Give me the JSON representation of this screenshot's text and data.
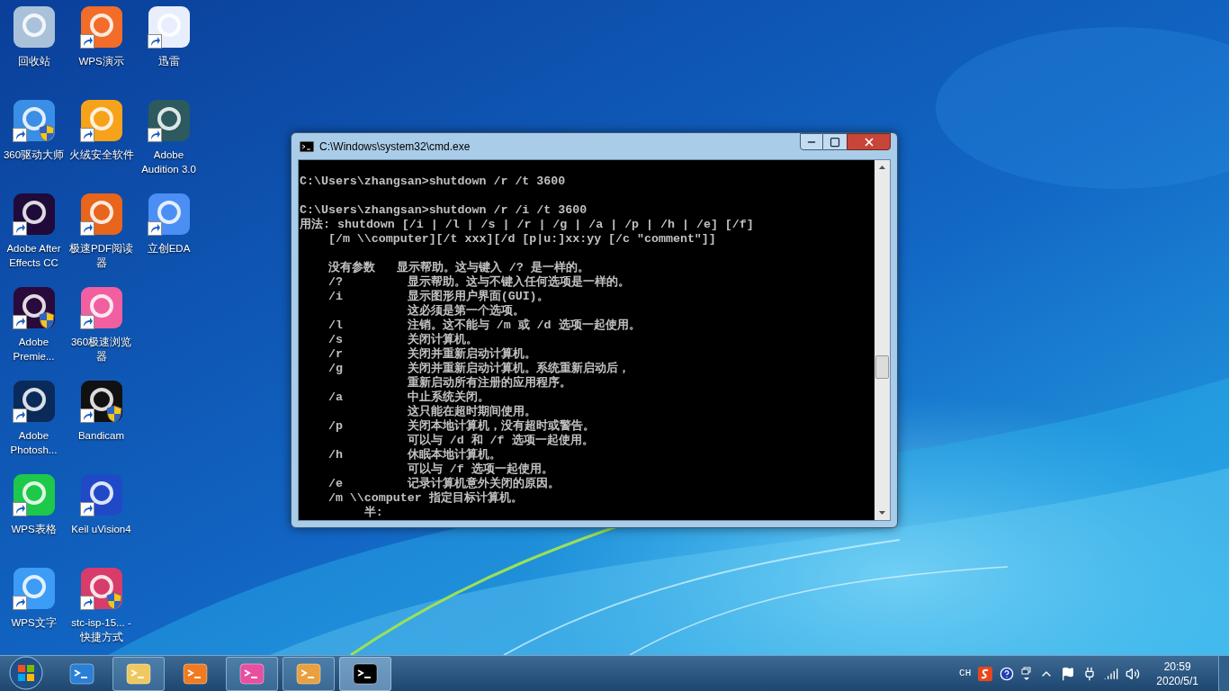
{
  "desktop": {
    "icons": [
      {
        "label": "回收站",
        "color": "#a9c2da",
        "shortcut": false,
        "shield": false
      },
      {
        "label": "360驱动大师",
        "color": "#3a8ee6",
        "shortcut": true,
        "shield": true
      },
      {
        "label": "Adobe After Effects CC",
        "color": "#1f0a3a",
        "shortcut": true,
        "shield": false
      },
      {
        "label": "Adobe Premie...",
        "color": "#2a0a3a",
        "shortcut": true,
        "shield": true
      },
      {
        "label": "Adobe Photosh...",
        "color": "#0a2a5a",
        "shortcut": true,
        "shield": false
      },
      {
        "label": "WPS表格",
        "color": "#1ec84a",
        "shortcut": true,
        "shield": false
      },
      {
        "label": "WPS文字",
        "color": "#3d9cf5",
        "shortcut": true,
        "shield": false
      },
      {
        "label": "WPS演示",
        "color": "#f26c2a",
        "shortcut": true,
        "shield": false
      },
      {
        "label": "火绒安全软件",
        "color": "#f7a21b",
        "shortcut": true,
        "shield": false
      },
      {
        "label": "极速PDF阅读器",
        "color": "#e8651c",
        "shortcut": true,
        "shield": false
      },
      {
        "label": "360极速浏览器",
        "color": "#f15fa0",
        "shortcut": true,
        "shield": false
      },
      {
        "label": "Bandicam",
        "color": "#111111",
        "shortcut": true,
        "shield": true
      },
      {
        "label": "Keil uVision4",
        "color": "#2049c8",
        "shortcut": true,
        "shield": false
      },
      {
        "label": "stc-isp-15... - 快捷方式",
        "color": "#d83c6a",
        "shortcut": true,
        "shield": true
      },
      {
        "label": "迅雷",
        "color": "#e8eefc",
        "shortcut": true,
        "shield": false
      },
      {
        "label": "Adobe Audition 3.0",
        "color": "#2c5a5e",
        "shortcut": true,
        "shield": false
      },
      {
        "label": "立创EDA",
        "color": "#4b8ff5",
        "shortcut": true,
        "shield": false
      }
    ]
  },
  "window": {
    "title": "C:\\Windows\\system32\\cmd.exe",
    "console": {
      "blocks": [
        [
          "C:\\Users\\zhangsan>shutdown /r /t 3600"
        ],
        [
          "C:\\Users\\zhangsan>shutdown /r /i /t 3600",
          "用法: shutdown [/i | /l | /s | /r | /g | /a | /p | /h | /e] [/f]",
          "    [/m \\\\computer][/t xxx][/d [p|u:]xx:yy [/c \"comment\"]]"
        ],
        [
          "    没有参数   显示帮助。这与键入 /? 是一样的。",
          "    /?         显示帮助。这与不键入任何选项是一样的。",
          "    /i         显示图形用户界面(GUI)。",
          "               这必须是第一个选项。",
          "    /l         注销。这不能与 /m 或 /d 选项一起使用。",
          "    /s         关闭计算机。",
          "    /r         关闭并重新启动计算机。",
          "    /g         关闭并重新启动计算机。系统重新启动后，",
          "               重新启动所有注册的应用程序。",
          "    /a         中止系统关闭。",
          "               这只能在超时期间使用。",
          "    /p         关闭本地计算机，没有超时或警告。",
          "               可以与 /d 和 /f 选项一起使用。",
          "    /h         休眠本地计算机。",
          "               可以与 /f 选项一起使用。",
          "    /e         记录计算机意外关闭的原因。",
          "    /m \\\\computer 指定目标计算机。",
          "         半:"
        ]
      ]
    }
  },
  "taskbar": {
    "items": [
      {
        "color": "#2a7fd6",
        "running": false,
        "selected": false
      },
      {
        "color": "#f0c860",
        "running": true,
        "selected": false
      },
      {
        "color": "#f07a20",
        "running": false,
        "selected": false
      },
      {
        "color": "#e84fa0",
        "running": true,
        "selected": false
      },
      {
        "color": "#e8a040",
        "running": true,
        "selected": false
      },
      {
        "color": "#000000",
        "running": true,
        "selected": true
      }
    ],
    "tray": {
      "language": "CH",
      "time": "20:59",
      "date": "2020/5/1"
    }
  }
}
